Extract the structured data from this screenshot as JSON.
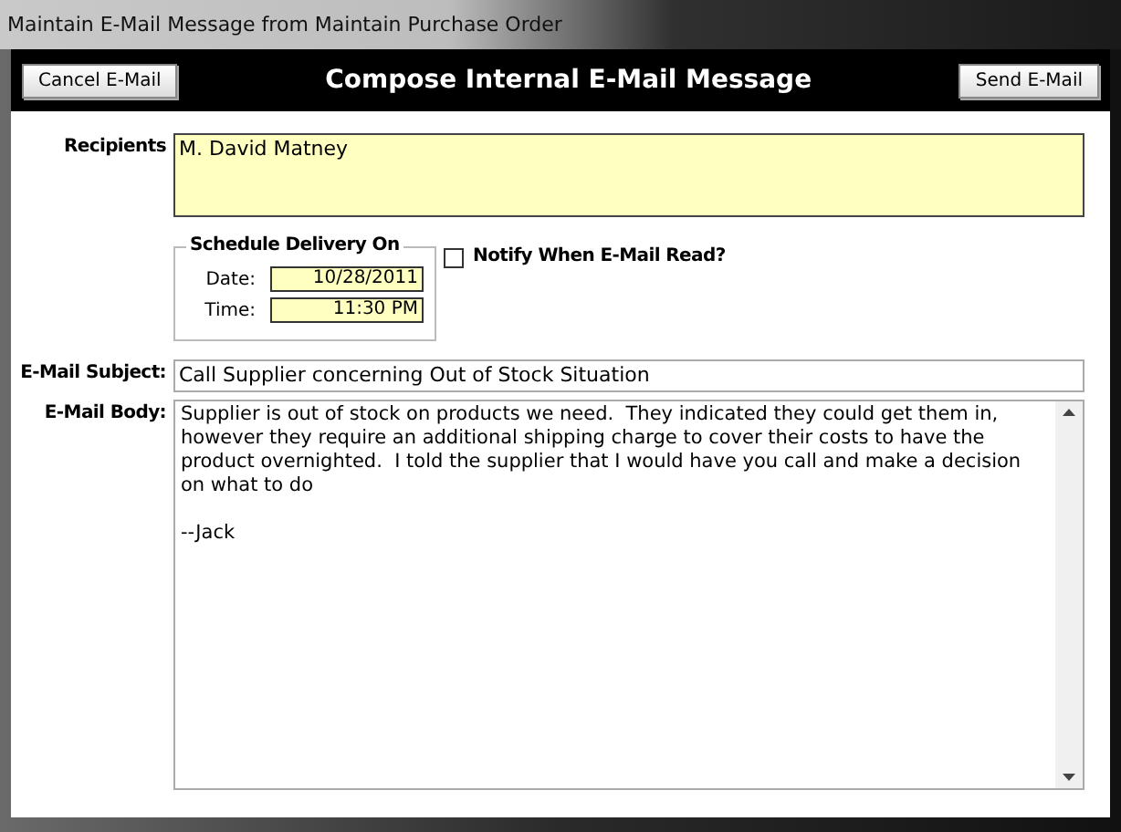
{
  "window": {
    "title": "Maintain E-Mail Message from Maintain Purchase Order"
  },
  "header": {
    "title": "Compose Internal E-Mail Message",
    "cancel_button": "Cancel E-Mail",
    "send_button": "Send E-Mail"
  },
  "recipients": {
    "label": "Recipients",
    "value": "M. David Matney"
  },
  "schedule": {
    "title": "Schedule Delivery On",
    "date_label": "Date:",
    "date": "10/28/2011",
    "time_label": "Time:",
    "time": "11:30 PM"
  },
  "notify": {
    "label": "Notify When E-Mail Read?",
    "checked": false
  },
  "subject": {
    "label": "E-Mail Subject:",
    "value": "Call Supplier concerning Out of Stock Situation"
  },
  "body": {
    "label": "E-Mail Body:",
    "value": "Supplier is out of stock on products we need.  They indicated they could get them in, however they require an additional shipping charge to cover their costs to have the product overnighted.  I told the supplier that I would have you call and make a decision on what to do\n\n--Jack"
  }
}
